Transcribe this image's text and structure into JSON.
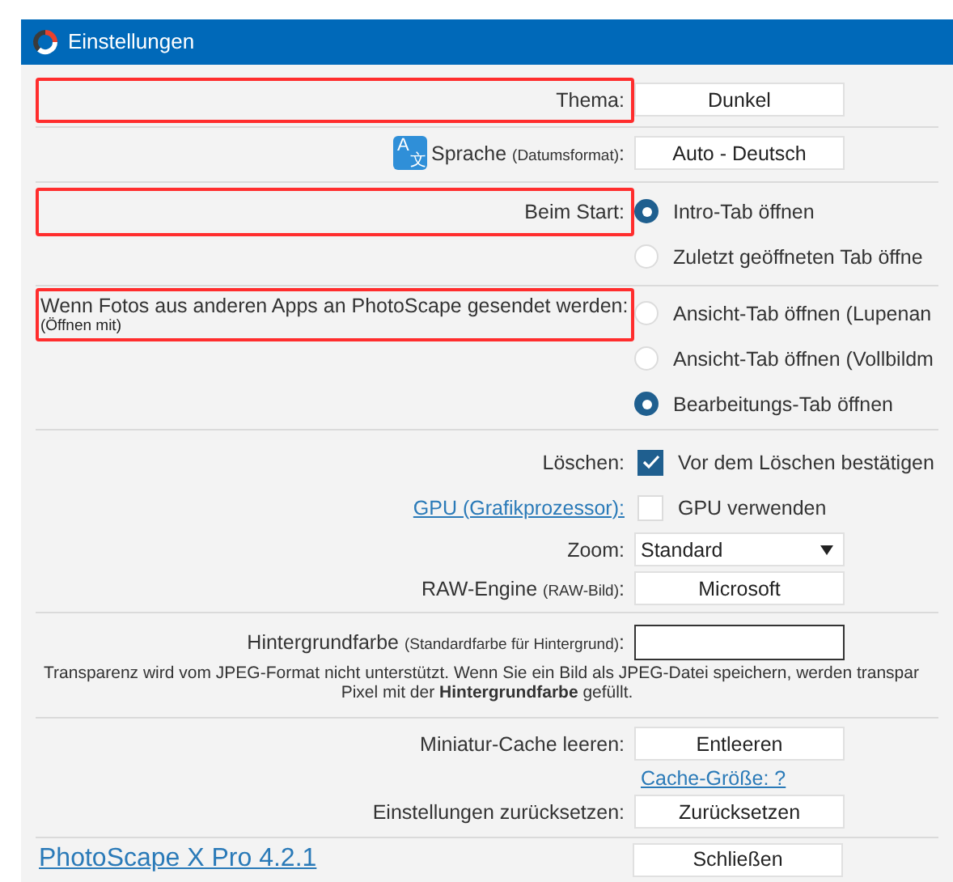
{
  "window": {
    "title": "Einstellungen"
  },
  "sections": [
    [
      {
        "kind": "button",
        "label": "Thema:",
        "highlighted": true,
        "label_link": false,
        "value": "Dunkel"
      }
    ],
    [
      {
        "kind": "button",
        "label": "Sprache",
        "label_note": "(Datumsformat)",
        "label_suffix": ":",
        "icon_glyphs": [
          "A",
          "文"
        ],
        "highlighted": false,
        "label_link": false,
        "value": "Auto - Deutsch"
      }
    ],
    [
      {
        "kind": "radio",
        "label": "Beim Start:",
        "highlighted": true,
        "label_link": false,
        "options": [
          {
            "label": "Intro-Tab öffnen",
            "selected": true
          },
          {
            "label": "Zuletzt geöffneten Tab öffne",
            "selected": false
          }
        ]
      }
    ],
    [
      {
        "kind": "radio",
        "label": "Wenn Fotos aus anderen Apps an PhotoScape gesendet werden:",
        "label_note": "(Öffnen mit)",
        "highlighted": true,
        "label_link": false,
        "options": [
          {
            "label": "Ansicht-Tab öffnen (Lupenan",
            "selected": false
          },
          {
            "label": "Ansicht-Tab öffnen (Vollbildm",
            "selected": false
          },
          {
            "label": "Bearbeitungs-Tab öffnen",
            "selected": true
          }
        ]
      }
    ],
    [
      {
        "kind": "checkbox",
        "label": "Löschen:",
        "highlighted": false,
        "label_link": false,
        "option": {
          "label": "Vor dem Löschen bestätigen",
          "checked": true
        }
      },
      {
        "kind": "checkbox",
        "label": "GPU (Grafikprozessor):",
        "highlighted": false,
        "label_link": true,
        "option": {
          "label": "GPU verwenden",
          "checked": false
        }
      },
      {
        "kind": "dropdown",
        "label": "Zoom:",
        "highlighted": false,
        "label_link": false,
        "value": "Standard"
      },
      {
        "kind": "button",
        "label": "RAW-Engine",
        "label_note": "(RAW-Bild)",
        "label_suffix": ":",
        "highlighted": false,
        "label_link": false,
        "value": "Microsoft"
      }
    ],
    [
      {
        "kind": "color",
        "label": "Hintergrundfarbe",
        "label_note": "(Standardfarbe für Hintergrund)",
        "label_suffix": ":",
        "highlighted": false,
        "label_link": false
      },
      {
        "kind": "note",
        "text": "Transparenz wird vom JPEG-Format nicht unterstützt. Wenn Sie ein Bild als JPEG-Datei speichern, werden transpar",
        "text2": "Pixel mit der **Hintergrundfarbe** gefüllt."
      }
    ],
    [
      {
        "kind": "button",
        "label": "Miniatur-Cache leeren:",
        "highlighted": false,
        "label_link": false,
        "value": "Entleeren"
      },
      {
        "kind": "link",
        "text": "Cache-Größe: ?"
      },
      {
        "kind": "button",
        "label": "Einstellungen zurücksetzen:",
        "highlighted": false,
        "label_link": false,
        "value": "Zurücksetzen"
      }
    ]
  ],
  "footer": {
    "version_link": "PhotoScape X Pro 4.2.1",
    "close_button": "Schließen"
  }
}
